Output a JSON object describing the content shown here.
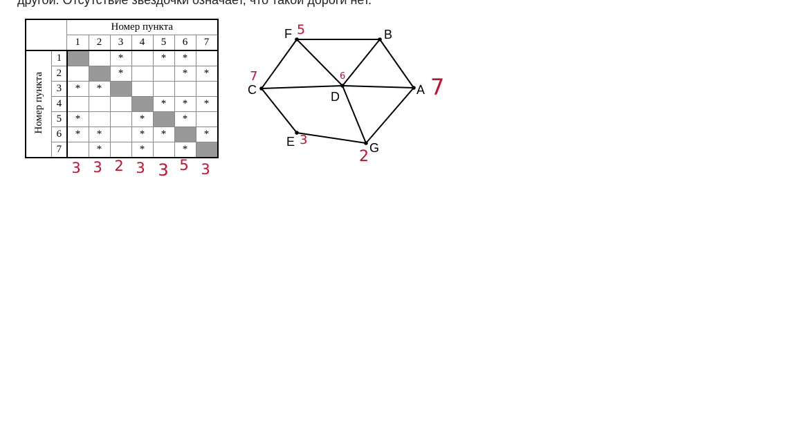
{
  "caption": "другой. Отсутствие звездочки означает, что такой дороги нет.",
  "table": {
    "col_header": "Номер пункта",
    "row_header": "Номер пункта",
    "columns": [
      "1",
      "2",
      "3",
      "4",
      "5",
      "6",
      "7"
    ],
    "rows": [
      {
        "label": "1",
        "cells": [
          "",
          "",
          "*",
          "",
          "*",
          "*",
          ""
        ]
      },
      {
        "label": "2",
        "cells": [
          "",
          "",
          "*",
          "",
          "",
          "*",
          "*"
        ]
      },
      {
        "label": "3",
        "cells": [
          "*",
          "*",
          "",
          "",
          "",
          "",
          ""
        ]
      },
      {
        "label": "4",
        "cells": [
          "",
          "",
          "",
          "",
          "*",
          "*",
          "*"
        ]
      },
      {
        "label": "5",
        "cells": [
          "*",
          "",
          "",
          "*",
          "",
          "*",
          ""
        ]
      },
      {
        "label": "6",
        "cells": [
          "*",
          "*",
          "",
          "*",
          "*",
          "",
          "*"
        ]
      },
      {
        "label": "7",
        "cells": [
          "",
          "*",
          "",
          "*",
          "",
          "*",
          ""
        ]
      }
    ],
    "handwritten_counts": [
      "3",
      "3",
      "2",
      "3",
      "3",
      "5",
      "3"
    ]
  },
  "graph": {
    "nodes": [
      {
        "id": "F",
        "label": "F",
        "note": "5"
      },
      {
        "id": "B",
        "label": "B",
        "note": ""
      },
      {
        "id": "C",
        "label": "C",
        "note": "7"
      },
      {
        "id": "D",
        "label": "D",
        "note": "6"
      },
      {
        "id": "A",
        "label": "A",
        "note": "7"
      },
      {
        "id": "E",
        "label": "E",
        "note": "3"
      },
      {
        "id": "G",
        "label": "G",
        "note": "2"
      }
    ],
    "edges": [
      [
        "F",
        "B"
      ],
      [
        "F",
        "C"
      ],
      [
        "F",
        "D"
      ],
      [
        "B",
        "D"
      ],
      [
        "B",
        "A"
      ],
      [
        "C",
        "D"
      ],
      [
        "D",
        "A"
      ],
      [
        "C",
        "E"
      ],
      [
        "E",
        "G"
      ],
      [
        "D",
        "G"
      ],
      [
        "G",
        "A"
      ]
    ]
  },
  "colors": {
    "ink": "#000000",
    "diagonal": "#999999",
    "handwriting": "#c8102e"
  }
}
